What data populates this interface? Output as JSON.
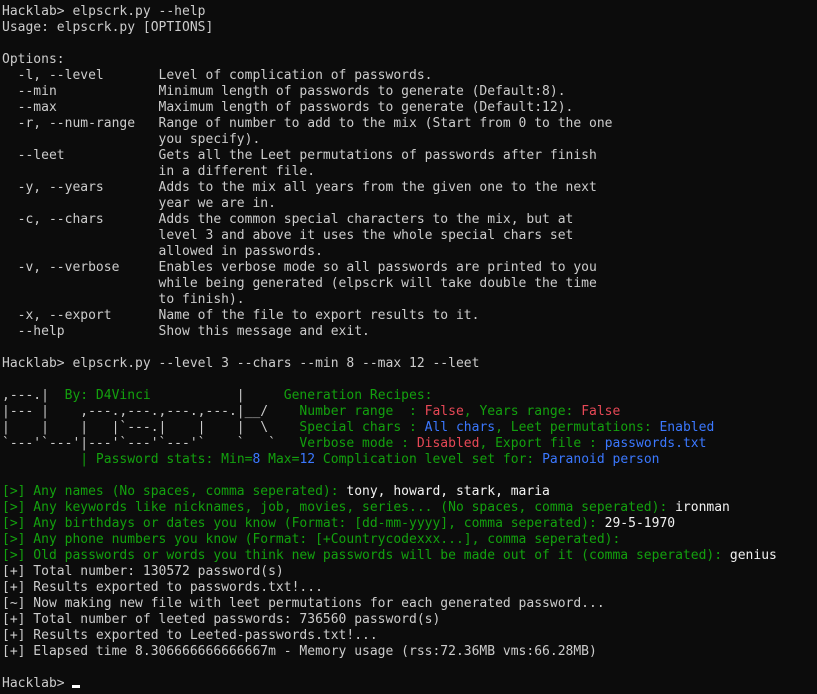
{
  "colors": {
    "default": "#cccccc",
    "green": "#13a10e",
    "red": "#e74856",
    "blue": "#3b78ff",
    "white": "#f2f2f2",
    "background": "#0c0c0c"
  },
  "terminal": {
    "lines": [
      [
        {
          "t": "Hacklab> elpscrk.py --help"
        }
      ],
      [
        {
          "t": "Usage: elpscrk.py [OPTIONS]"
        }
      ],
      [
        {
          "t": ""
        }
      ],
      [
        {
          "t": "Options:"
        }
      ],
      [
        {
          "t": "  -l, --level       Level of complication of passwords."
        }
      ],
      [
        {
          "t": "  --min             Minimum length of passwords to generate (Default:8)."
        }
      ],
      [
        {
          "t": "  --max             Maximum length of passwords to generate (Default:12)."
        }
      ],
      [
        {
          "t": "  -r, --num-range   Range of number to add to the mix (Start from 0 to the one"
        }
      ],
      [
        {
          "t": "                    you specify)."
        }
      ],
      [
        {
          "t": "  --leet            Gets all the Leet permutations of passwords after finish"
        }
      ],
      [
        {
          "t": "                    in a different file."
        }
      ],
      [
        {
          "t": "  -y, --years       Adds to the mix all years from the given one to the next"
        }
      ],
      [
        {
          "t": "                    year we are in."
        }
      ],
      [
        {
          "t": "  -c, --chars       Adds the common special characters to the mix, but at"
        }
      ],
      [
        {
          "t": "                    level 3 and above it uses the whole special chars set"
        }
      ],
      [
        {
          "t": "                    allowed in passwords."
        }
      ],
      [
        {
          "t": "  -v, --verbose     Enables verbose mode so all passwords are printed to you"
        }
      ],
      [
        {
          "t": "                    while being generated (elpscrk will take double the time"
        }
      ],
      [
        {
          "t": "                    to finish)."
        }
      ],
      [
        {
          "t": "  -x, --export      Name of the file to export results to it."
        }
      ],
      [
        {
          "t": "  --help            Show this message and exit."
        }
      ],
      [
        {
          "t": ""
        }
      ],
      [
        {
          "t": "Hacklab> elpscrk.py --level 3 --chars --min 8 --max 12 --leet"
        }
      ],
      [
        {
          "t": ""
        }
      ],
      [
        {
          "t": ",---.|  "
        },
        {
          "t": "By: D4Vinci",
          "c": "green"
        },
        {
          "t": "           |     "
        },
        {
          "t": "Generation Recipes:",
          "c": "green"
        }
      ],
      [
        {
          "t": "|--- |    ,---.,---.,---.,---.|__/    "
        },
        {
          "t": "Number range  : ",
          "c": "green"
        },
        {
          "t": "False",
          "c": "red"
        },
        {
          "t": ", Years range: ",
          "c": "green"
        },
        {
          "t": "False",
          "c": "red"
        }
      ],
      [
        {
          "t": "|    |    |   |`---.|    |    |  \\    "
        },
        {
          "t": "Special chars : ",
          "c": "green"
        },
        {
          "t": "All chars",
          "c": "blue"
        },
        {
          "t": ", Leet permutations: ",
          "c": "green"
        },
        {
          "t": "Enabled",
          "c": "blue"
        }
      ],
      [
        {
          "t": "`---'`---'|---'`---'`---'`    `   `   "
        },
        {
          "t": "Verbose mode : ",
          "c": "green"
        },
        {
          "t": "Disabled",
          "c": "red"
        },
        {
          "t": ", Export file : ",
          "c": "green"
        },
        {
          "t": "passwords.txt",
          "c": "blue"
        }
      ],
      [
        {
          "t": "          "
        },
        {
          "t": "| Password stats: Min=",
          "c": "green"
        },
        {
          "t": "8",
          "c": "blue"
        },
        {
          "t": " Max=",
          "c": "green"
        },
        {
          "t": "12",
          "c": "blue"
        },
        {
          "t": " Complication level set for: ",
          "c": "green"
        },
        {
          "t": "Paranoid person",
          "c": "blue"
        }
      ],
      [
        {
          "t": ""
        }
      ],
      [
        {
          "t": "[>] Any names (No spaces, comma seperated): ",
          "c": "green"
        },
        {
          "t": "tony, howard, stark, maria",
          "c": "white"
        }
      ],
      [
        {
          "t": "[>] Any keywords like nicknames, job, movies, series... (No spaces, comma seperated): ",
          "c": "green"
        },
        {
          "t": "ironman",
          "c": "white"
        }
      ],
      [
        {
          "t": "[>] Any birthdays or dates you know (Format: [dd-mm-yyyy], comma seperated): ",
          "c": "green"
        },
        {
          "t": "29-5-1970",
          "c": "white"
        }
      ],
      [
        {
          "t": "[>] Any phone numbers you know (Format: [+Countrycodexxx...], comma seperated):",
          "c": "green"
        }
      ],
      [
        {
          "t": "[>] Old passwords or words you think new passwords will be made out of it (comma seperated): ",
          "c": "green"
        },
        {
          "t": "genius",
          "c": "white"
        }
      ],
      [
        {
          "t": "[+] Total number: 130572 password(s)"
        }
      ],
      [
        {
          "t": "[+] Results exported to passwords.txt!..."
        }
      ],
      [
        {
          "t": "[~] Now making new file with leet permutations for each generated password..."
        }
      ],
      [
        {
          "t": "[+] Total number of leeted passwords: 736560 password(s)"
        }
      ],
      [
        {
          "t": "[+] Results exported to Leeted-passwords.txt!..."
        }
      ],
      [
        {
          "t": "[+] Elapsed time 8.306666666666667m - Memory usage (rss:72.36MB vms:66.28MB)"
        }
      ],
      [
        {
          "t": ""
        }
      ],
      [
        {
          "t": "Hacklab> "
        }
      ]
    ]
  }
}
